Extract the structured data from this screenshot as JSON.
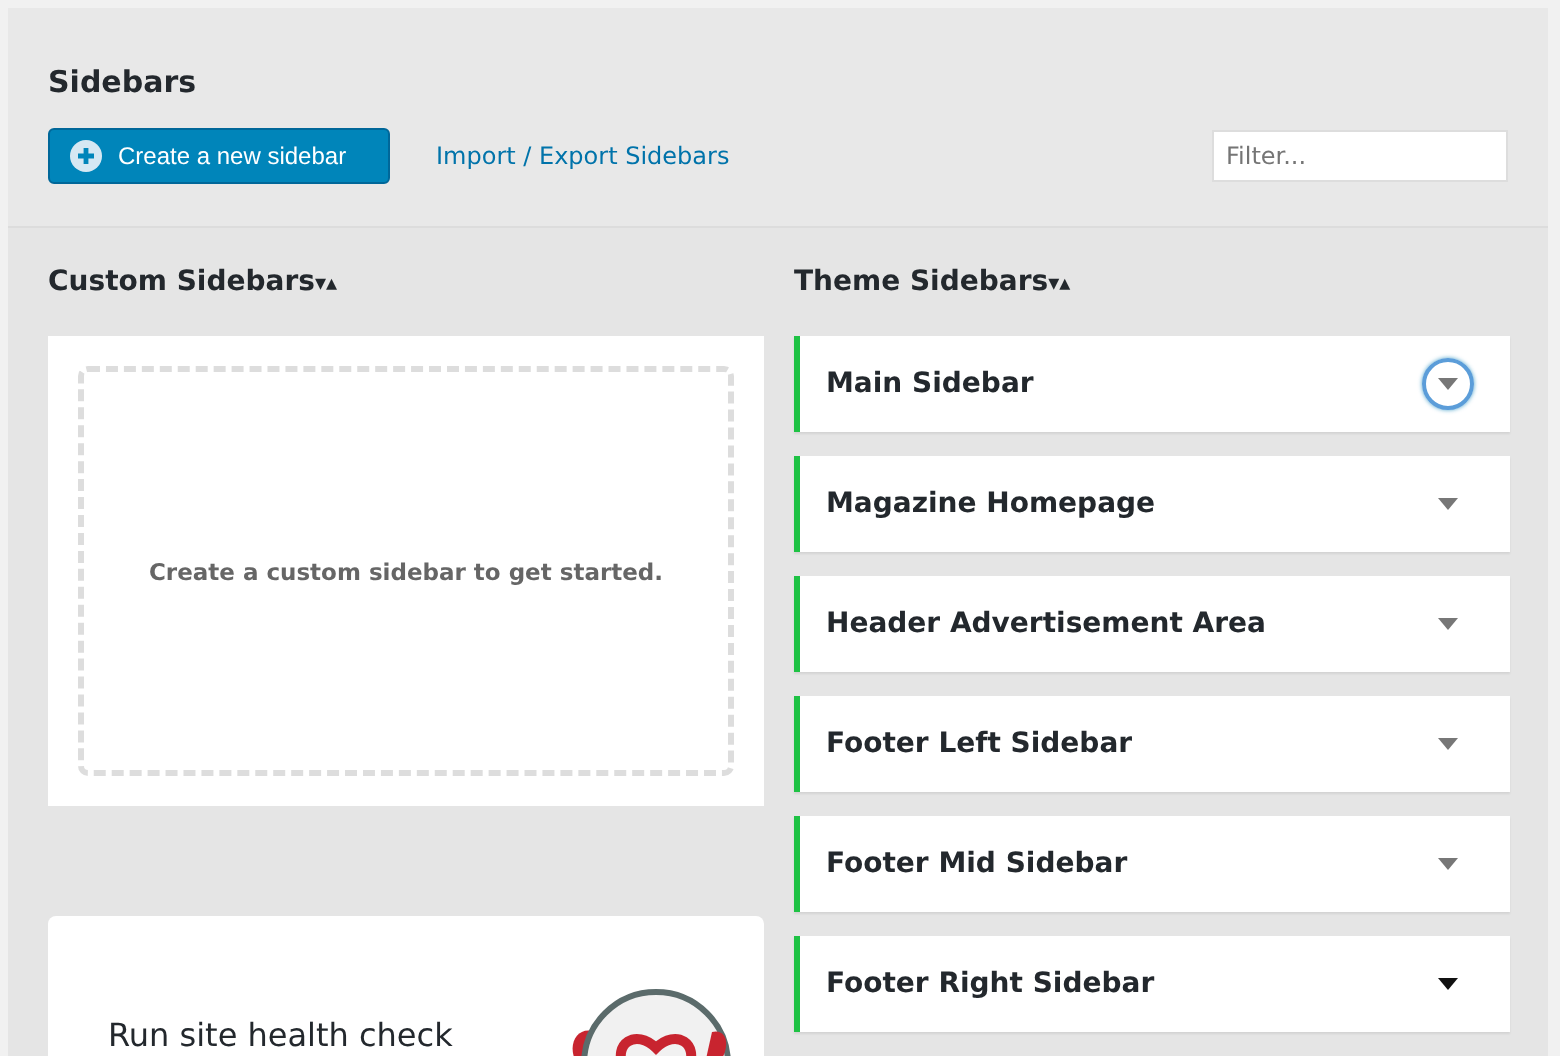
{
  "header": {
    "title": "Sidebars",
    "create_button": "Create a new sidebar",
    "import_link": "Import / Export Sidebars",
    "filter": {
      "placeholder": "Filter..."
    }
  },
  "custom_sidebars": {
    "heading": "Custom Sidebars",
    "sort_icon": "▾▴",
    "empty_message": "Create a custom sidebar to get started."
  },
  "theme_sidebars": {
    "heading": "Theme Sidebars",
    "sort_icon": "▾▴",
    "items": [
      {
        "name": "Main Sidebar",
        "focused": true,
        "hovered": false
      },
      {
        "name": "Magazine Homepage",
        "focused": false,
        "hovered": false
      },
      {
        "name": "Header Advertisement Area",
        "focused": false,
        "hovered": false
      },
      {
        "name": "Footer Left Sidebar",
        "focused": false,
        "hovered": false
      },
      {
        "name": "Footer Mid Sidebar",
        "focused": false,
        "hovered": false
      },
      {
        "name": "Footer Right Sidebar",
        "focused": false,
        "hovered": true
      }
    ]
  },
  "health_card": {
    "title": "Run site health check"
  }
}
